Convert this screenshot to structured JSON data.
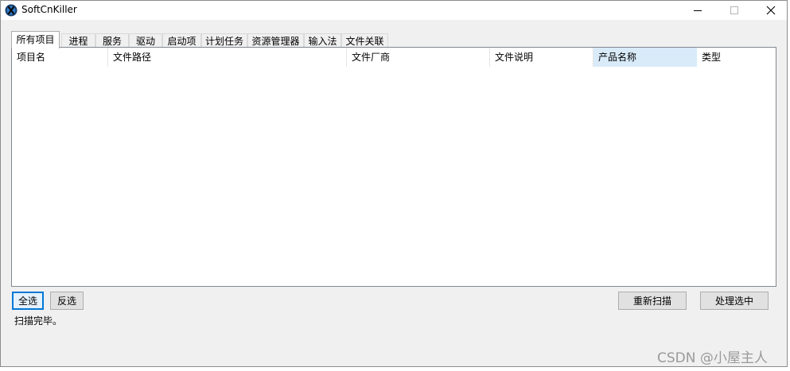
{
  "window": {
    "title": "SoftCnKiller",
    "icon": "softcnkiller-app-icon"
  },
  "tabs": [
    {
      "label": "所有项目",
      "active": true
    },
    {
      "label": "进程",
      "active": false
    },
    {
      "label": "服务",
      "active": false
    },
    {
      "label": "驱动",
      "active": false
    },
    {
      "label": "启动项",
      "active": false
    },
    {
      "label": "计划任务",
      "active": false
    },
    {
      "label": "资源管理器",
      "active": false
    },
    {
      "label": "输入法",
      "active": false
    },
    {
      "label": "文件关联",
      "active": false
    }
  ],
  "table": {
    "columns": [
      "项目名",
      "文件路径",
      "文件厂商",
      "文件说明",
      "产品名称",
      "类型"
    ],
    "rows": []
  },
  "buttons": {
    "select_all": "全选",
    "invert_selection": "反选",
    "rescan": "重新扫描",
    "process_selected": "处理选中"
  },
  "status": "扫描完毕。",
  "watermark": "CSDN @小屋主人",
  "colors": {
    "header_hover": "#d9ebf9",
    "focus_blue": "#0078d7",
    "window_bg": "#f0f0f0"
  }
}
